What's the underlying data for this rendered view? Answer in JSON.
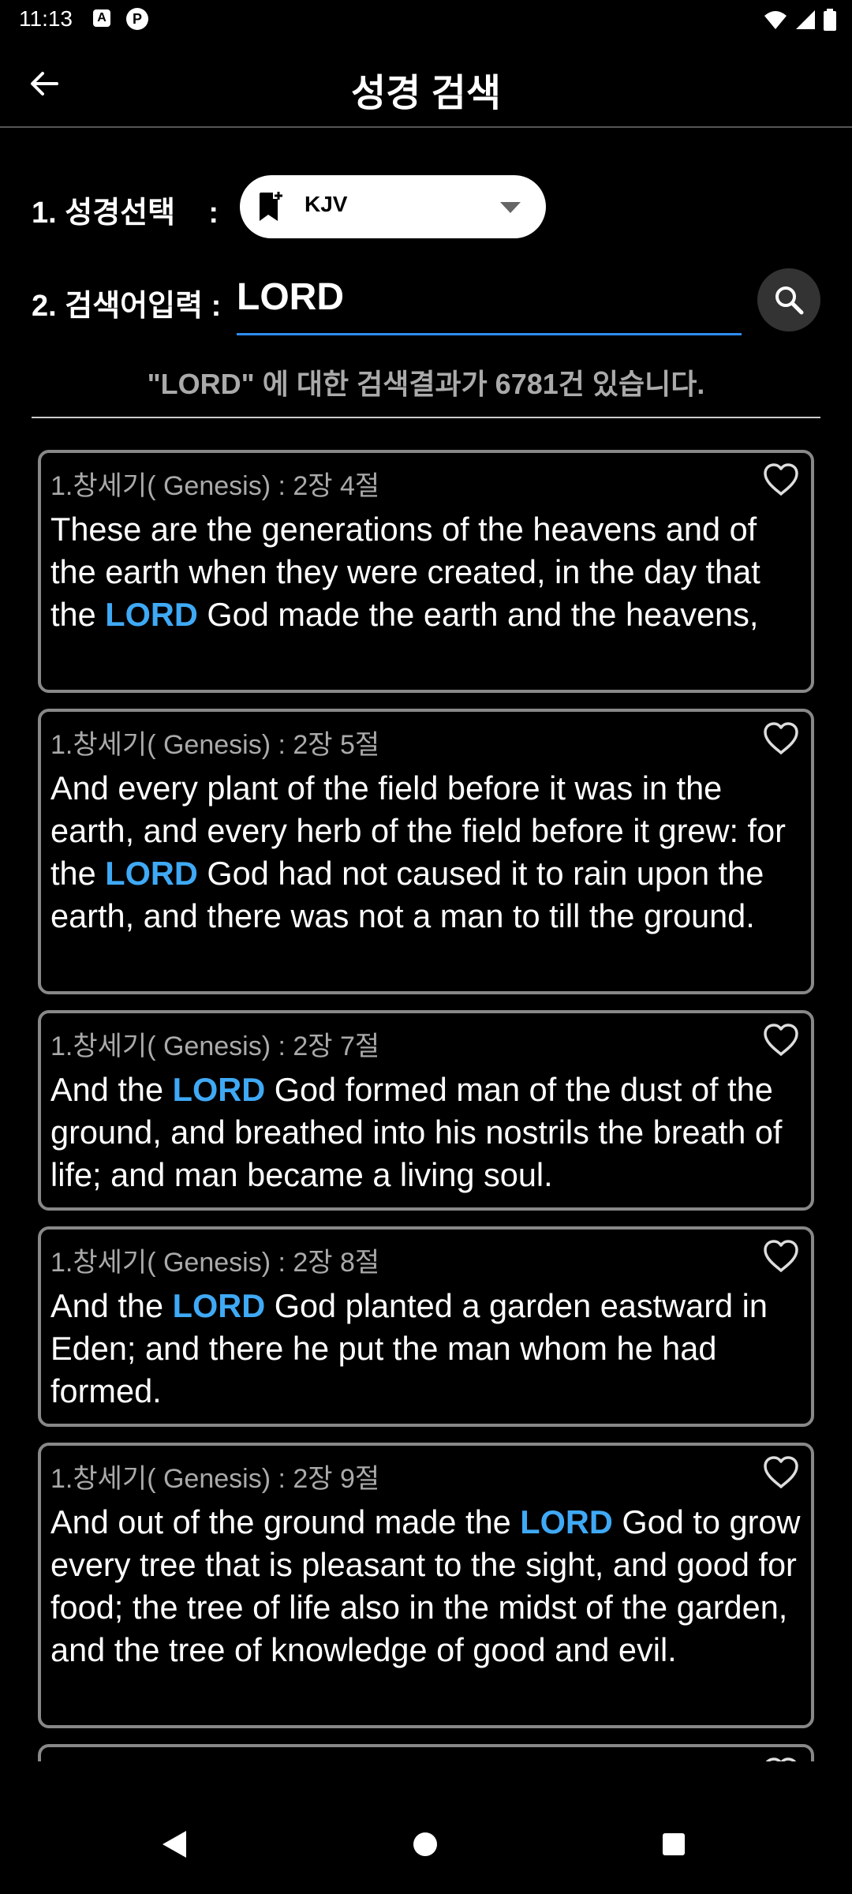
{
  "status_bar": {
    "time": "11:13",
    "icon_a": "A",
    "icon_p": "P",
    "icons": [
      "wifi-icon",
      "signal-icon",
      "battery-icon"
    ]
  },
  "app_bar": {
    "title": "성경 검색",
    "back_icon": "arrow-left-icon"
  },
  "form": {
    "version_label": "1. 성경선택    :",
    "version_value": "KJV",
    "search_label": "2. 검색어입력 :",
    "search_value": "LORD"
  },
  "summary": "\"LORD\" 에 대한 검색결과가 6781건 있습니다.",
  "highlight_word": "LORD",
  "colors": {
    "accent_blue": "#3fa9f5",
    "underline_blue": "#2f8cf2",
    "card_border": "#888888",
    "background": "#000000"
  },
  "results": [
    {
      "ref": "1.창세기( Genesis) : 2장 4절",
      "text": "These are the generations of the heavens and of the earth when they were created, in the day that the LORD God made the earth and the heavens,"
    },
    {
      "ref": "1.창세기( Genesis) : 2장 5절",
      "text": "And every plant of the field before it was in the earth, and every herb of the field before it grew: for the LORD God had not caused it to rain upon the earth, and there was not a man to till the ground."
    },
    {
      "ref": "1.창세기( Genesis) : 2장 7절",
      "text": "And the LORD God formed man of the dust of the ground, and breathed into his nostrils the breath of life; and man became a living soul."
    },
    {
      "ref": "1.창세기( Genesis) : 2장 8절",
      "text": "And the LORD God planted a garden eastward in Eden; and there he put the man whom he had formed."
    },
    {
      "ref": "1.창세기( Genesis) : 2장 9절",
      "text": "And out of the ground made the LORD God to grow every tree that is pleasant to the sight, and good for food; the tree of life also in the midst of the garden, and the tree of knowledge of good and evil."
    }
  ],
  "nav_bar": {
    "back_icon": "nav-back-icon",
    "home_icon": "nav-home-icon",
    "recents_icon": "nav-recents-icon"
  }
}
